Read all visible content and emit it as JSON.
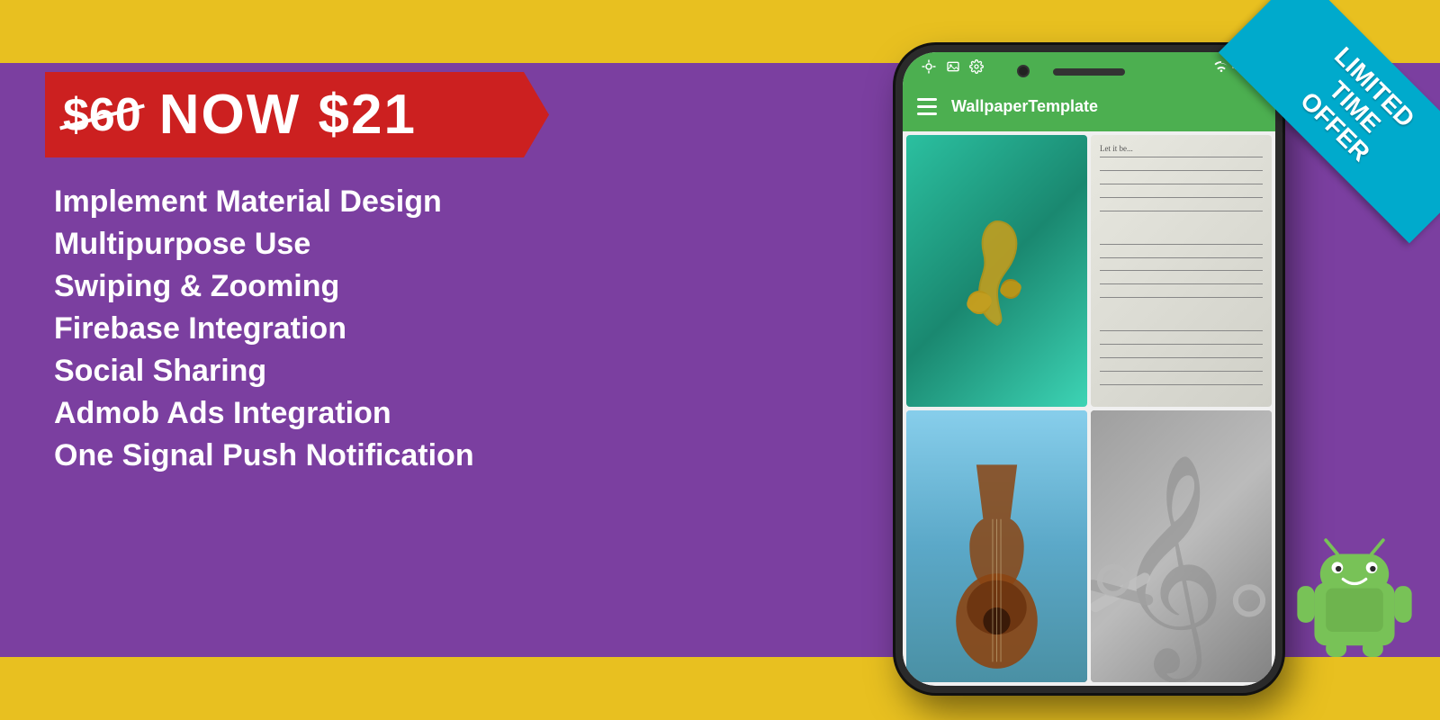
{
  "page": {
    "background_color": "#7B3FA0",
    "top_bar_color": "#E8C020",
    "bottom_bar_color": "#E8C020"
  },
  "price_banner": {
    "old_price": "$60",
    "now_label": "NOW",
    "new_price": "$21",
    "bg_color": "#CC2020"
  },
  "features": [
    {
      "label": "Implement Material Design"
    },
    {
      "label": "Multipurpose Use"
    },
    {
      "label": "Swiping & Zooming"
    },
    {
      "label": "Firebase Integration"
    },
    {
      "label": "Social Sharing"
    },
    {
      "label": "Admob Ads Integration"
    },
    {
      "label": "One Signal Push Notification"
    }
  ],
  "phone": {
    "app_title": "WallpaperTemplate",
    "status_bar_color": "#4CAF50",
    "toolbar_color": "#4CAF50"
  },
  "ribbon": {
    "line1": "LIMITED",
    "line2": "TIME",
    "line3": "OFFER",
    "bg_color": "#00AACC"
  }
}
